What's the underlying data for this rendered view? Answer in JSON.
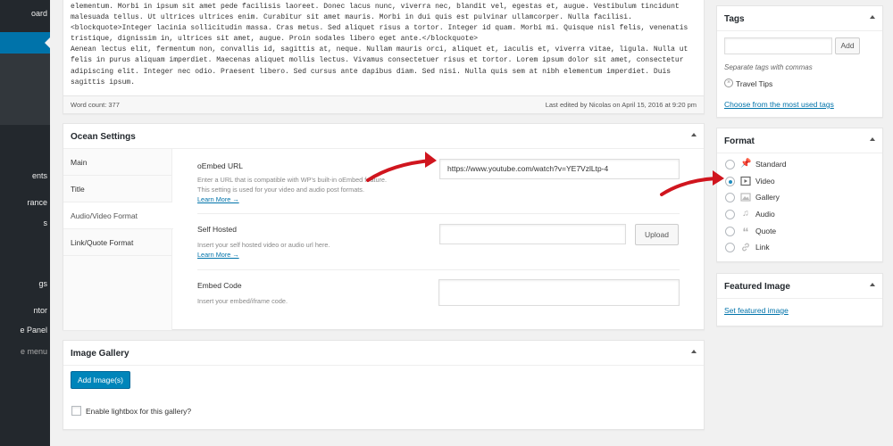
{
  "sidebar": {
    "items": [
      {
        "label": "oard"
      },
      {
        "label": "ents"
      },
      {
        "label": "rance"
      },
      {
        "label": "s"
      },
      {
        "label": "gs"
      },
      {
        "label": "ntor"
      },
      {
        "label": "e Panel"
      },
      {
        "label": "e menu"
      }
    ]
  },
  "editor": {
    "lines": [
      "elementum. Morbi in ipsum sit amet pede facilisis laoreet. Donec lacus nunc, viverra nec, blandit vel, egestas et, augue. Vestibulum tincidunt",
      "malesuada tellus. Ut ultrices ultrices enim. Curabitur sit amet mauris. Morbi in dui quis est pulvinar ullamcorper. Nulla facilisi.",
      "<blockquote>Integer lacinia sollicitudin massa. Cras metus. Sed aliquet risus a tortor. Integer id quam. Morbi mi. Quisque nisl felis, venenatis",
      "tristique, dignissim in, ultrices sit amet, augue. Proin sodales libero eget ante.</blockquote>",
      "Aenean lectus elit, fermentum non, convallis id, sagittis at, neque. Nullam mauris orci, aliquet et, iaculis et, viverra vitae, ligula. Nulla ut",
      "felis in purus aliquam imperdiet. Maecenas aliquet mollis lectus. Vivamus consectetuer risus et tortor. Lorem ipsum dolor sit amet, consectetur",
      "adipiscing elit. Integer nec odio. Praesent libero. Sed cursus ante dapibus diam. Sed nisi. Nulla quis sem at nibh elementum imperdiet. Duis",
      "sagittis ipsum."
    ],
    "word_count": "Word count: 377",
    "last_edited": "Last edited by Nicolas on April 15, 2016 at 9:20 pm"
  },
  "ocean": {
    "title": "Ocean Settings",
    "tabs": [
      {
        "label": "Main"
      },
      {
        "label": "Title"
      },
      {
        "label": "Audio/Video Format"
      },
      {
        "label": "Link/Quote Format"
      }
    ],
    "oembed": {
      "label": "oEmbed URL",
      "value": "https://www.youtube.com/watch?v=YE7VzlLtp-4",
      "desc1": "Enter a URL that is compatible with WP's built-in oEmbed feature.",
      "desc2": "This setting is used for your video and audio post formats.",
      "learn_more": "Learn More →"
    },
    "self_hosted": {
      "label": "Self Hosted",
      "value": "",
      "desc": "Insert your self hosted video or audio url here.",
      "learn_more": "Learn More →",
      "upload": "Upload"
    },
    "embed_code": {
      "label": "Embed Code",
      "value": "",
      "desc": "Insert your embed/iframe code."
    }
  },
  "gallery": {
    "title": "Image Gallery",
    "add_button": "Add Image(s)",
    "lightbox_label": "Enable lightbox for this gallery?",
    "lightbox_checked": false
  },
  "tags": {
    "title": "Tags",
    "input_value": "",
    "add_button": "Add",
    "hint": "Separate tags with commas",
    "existing": [
      {
        "label": "Travel Tips"
      }
    ],
    "choose_link": "Choose from the most used tags"
  },
  "format": {
    "title": "Format",
    "selected": "Video",
    "options": [
      {
        "label": "Standard",
        "icon": "pin-icon"
      },
      {
        "label": "Video",
        "icon": "video-icon"
      },
      {
        "label": "Gallery",
        "icon": "gallery-icon"
      },
      {
        "label": "Audio",
        "icon": "audio-icon"
      },
      {
        "label": "Quote",
        "icon": "quote-icon"
      },
      {
        "label": "Link",
        "icon": "link-icon"
      }
    ]
  },
  "featured": {
    "title": "Featured Image",
    "link": "Set featured image"
  },
  "colors": {
    "sidebar": "#23282d",
    "accent": "#0073aa",
    "primary_button": "#0085ba",
    "annotation_arrow": "#d0151e"
  }
}
